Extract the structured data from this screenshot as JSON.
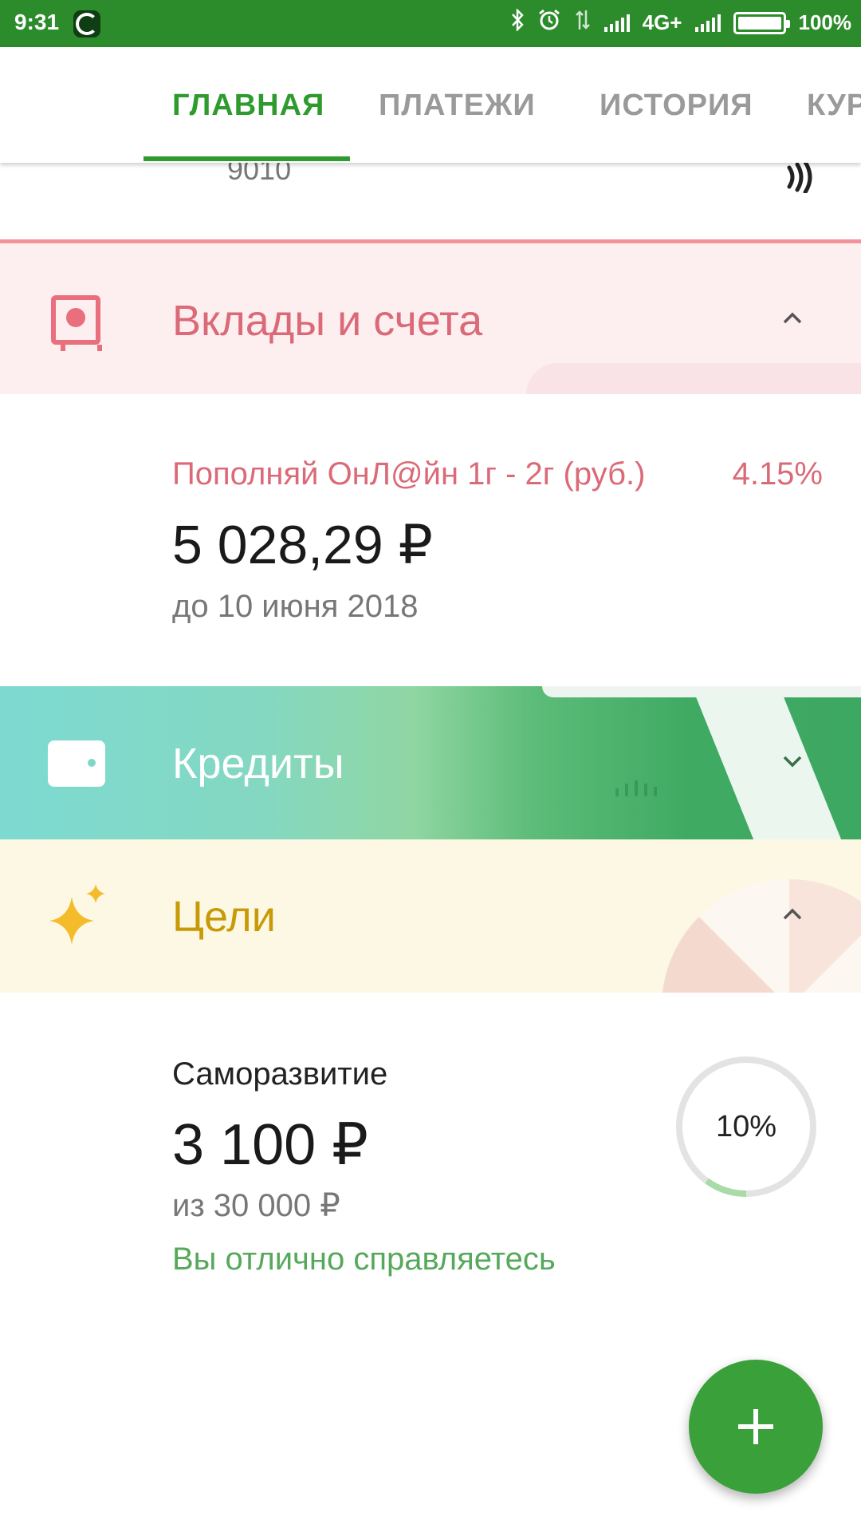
{
  "status_bar": {
    "time": "9:31",
    "network": "4G+",
    "battery": "100%",
    "icons": [
      "sberbank-app-icon",
      "bluetooth-icon",
      "alarm-icon",
      "data-transfer-icon",
      "signal-icon",
      "battery-icon"
    ]
  },
  "tabs": [
    {
      "label": "ГЛАВНАЯ",
      "active": true
    },
    {
      "label": "ПЛАТЕЖИ",
      "active": false
    },
    {
      "label": "ИСТОРИЯ",
      "active": false
    },
    {
      "label": "КУР",
      "active": false
    }
  ],
  "card_tail": {
    "number": "9010"
  },
  "deposits": {
    "title": "Вклады и счета",
    "icon": "safe-icon",
    "expanded": true,
    "accent": "#db6a78",
    "items": [
      {
        "name": "Пополняй ОнЛ@йн 1г - 2г (руб.)",
        "rate": "4.15%",
        "amount": "5 028,29 ₽",
        "until": "до 10 июня 2018"
      }
    ]
  },
  "credits": {
    "title": "Кредиты",
    "icon": "wallet-icon",
    "expanded": false
  },
  "goals": {
    "title": "Цели",
    "icon": "sparkle-icon",
    "expanded": true,
    "accent": "#c99a07",
    "items": [
      {
        "name": "Саморазвитие",
        "amount": "3 100 ₽",
        "target": "из 30 000 ₽",
        "status": "Вы отлично справляетесь",
        "progress_label": "10%",
        "progress": 0.1
      }
    ]
  },
  "fab": {
    "icon": "plus-icon"
  }
}
